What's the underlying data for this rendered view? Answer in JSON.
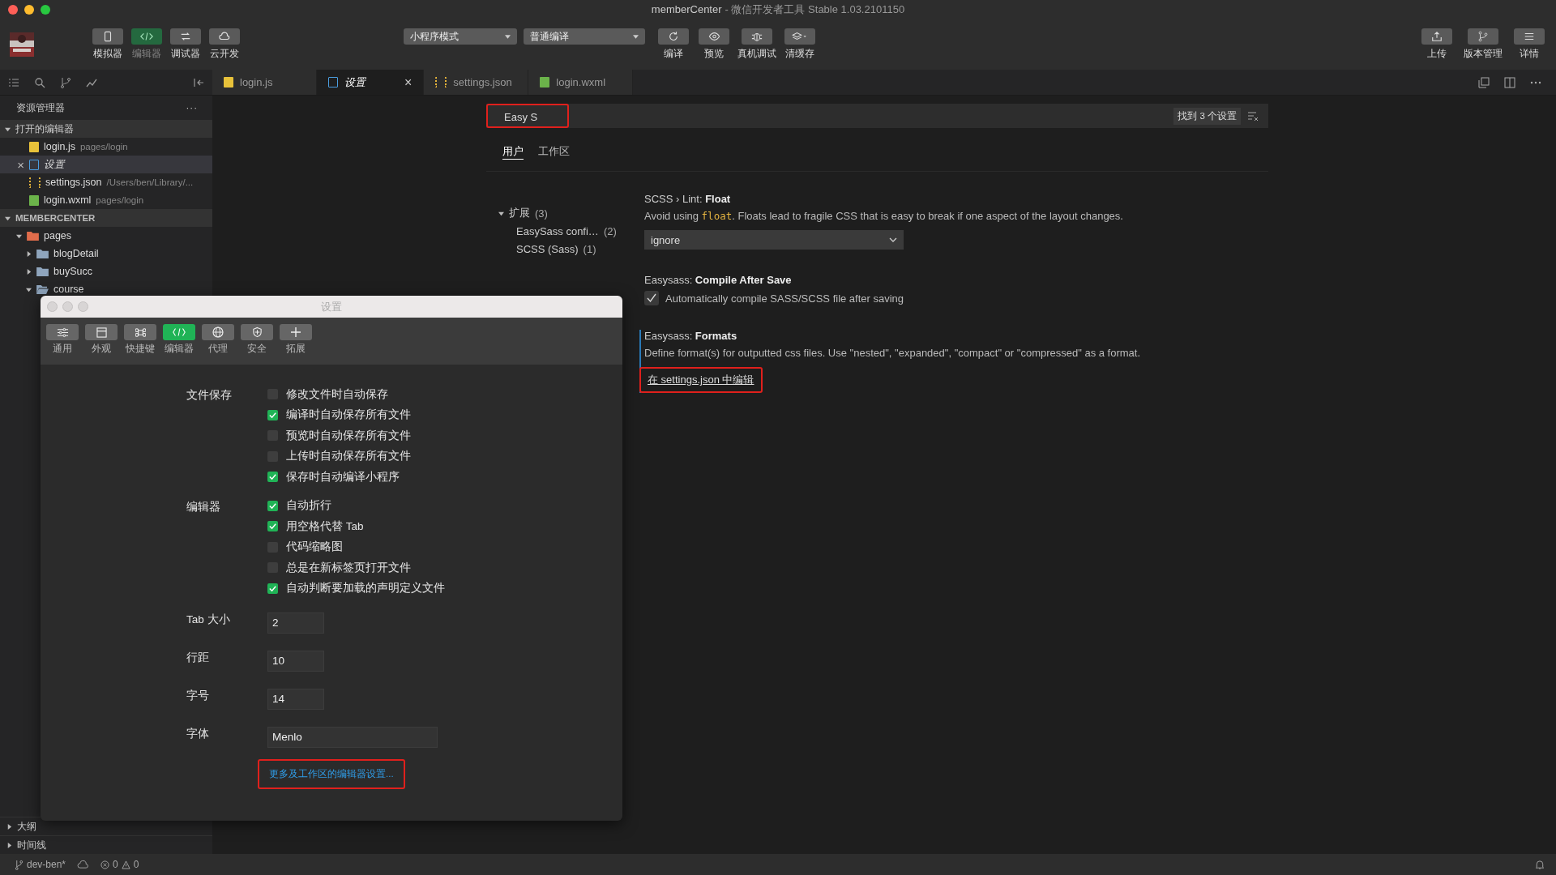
{
  "window": {
    "title": "memberCenter",
    "subtitle": "- 微信开发者工具 Stable 1.03.2101150"
  },
  "toolbar": {
    "left": [
      {
        "label": "模拟器",
        "kind": "phone",
        "selected": false
      },
      {
        "label": "编辑器",
        "kind": "code",
        "selected": true
      },
      {
        "label": "调试器",
        "kind": "debug",
        "selected": false
      },
      {
        "label": "云开发",
        "kind": "cloud",
        "selected": false
      }
    ],
    "mode": "小程序模式",
    "compile": "普通编译",
    "actions": [
      {
        "label": "编译",
        "kind": "refresh"
      },
      {
        "label": "预览",
        "kind": "eye"
      },
      {
        "label": "真机调试",
        "kind": "bug"
      },
      {
        "label": "清缓存",
        "kind": "layers"
      }
    ],
    "right": [
      {
        "label": "上传",
        "kind": "upload"
      },
      {
        "label": "版本管理",
        "kind": "branch"
      },
      {
        "label": "详情",
        "kind": "menu"
      }
    ]
  },
  "tabs": [
    {
      "label": "login.js",
      "kind": "js",
      "selected": false
    },
    {
      "label": "设置",
      "kind": "file",
      "selected": true,
      "close": "×"
    },
    {
      "label": "settings.json",
      "kind": "json",
      "selected": false
    },
    {
      "label": "login.wxml",
      "kind": "wxml",
      "selected": false
    }
  ],
  "sidebar": {
    "title": "资源管理器",
    "more": "···",
    "open_editors": {
      "label": "打开的编辑器",
      "items": [
        {
          "name": "login.js",
          "path": "pages/login",
          "kind": "js",
          "selected": false
        },
        {
          "name": "设置",
          "kind": "file",
          "selected": true,
          "close": "×"
        },
        {
          "name": "settings.json",
          "path": "/Users/ben/Library/...",
          "kind": "json",
          "selected": false
        },
        {
          "name": "login.wxml",
          "path": "pages/login",
          "kind": "wxml",
          "selected": false
        }
      ]
    },
    "project": {
      "label": "MEMBERCENTER",
      "tree": [
        {
          "name": "pages",
          "kind": "root",
          "expanded": true,
          "children": [
            {
              "name": "blogDetail",
              "expanded": false
            },
            {
              "name": "buySucc",
              "expanded": false
            },
            {
              "name": "course",
              "expanded": true
            }
          ]
        }
      ]
    },
    "bottom": [
      {
        "label": "大纲"
      },
      {
        "label": "时间线"
      }
    ]
  },
  "settings": {
    "search": {
      "value": "Easy S",
      "highlighted": true
    },
    "result_count": "找到 3 个设置",
    "scopes": [
      {
        "label": "用户",
        "selected": true
      },
      {
        "label": "工作区",
        "selected": false
      }
    ],
    "toc": [
      {
        "label": "扩展",
        "count": "(3)",
        "expanded": true,
        "children": [
          {
            "label": "EasySass confi…",
            "count": "(2)"
          },
          {
            "label": "SCSS (Sass)",
            "count": "(1)"
          }
        ]
      }
    ],
    "items": [
      {
        "kind": "select",
        "category": "SCSS › Lint: ",
        "name": "Float",
        "description_before": "Avoid using ",
        "code": "float",
        "description_after": ". Floats lead to fragile CSS that is easy to break if one aspect of the layout changes.",
        "value": "ignore"
      },
      {
        "kind": "checkbox",
        "category": "Easysass: ",
        "name": "Compile After Save",
        "label": "Automatically compile SASS/SCSS file after saving",
        "checked": true
      },
      {
        "kind": "link",
        "category": "Easysass: ",
        "name": "Formats",
        "description": "Define format(s) for outputted css files. Use \"nested\", \"expanded\", \"compact\" or \"compressed\" as a format.",
        "link": "在 settings.json 中编辑",
        "focused": true,
        "highlighted": true
      }
    ]
  },
  "dialog": {
    "title": "设置",
    "tabs": [
      {
        "label": "通用",
        "kind": "list",
        "selected": false
      },
      {
        "label": "外观",
        "kind": "window",
        "selected": false
      },
      {
        "label": "快捷键",
        "kind": "command",
        "selected": false
      },
      {
        "label": "编辑器",
        "kind": "code",
        "selected": true
      },
      {
        "label": "代理",
        "kind": "globe",
        "selected": false
      },
      {
        "label": "安全",
        "kind": "shield",
        "selected": false
      },
      {
        "label": "拓展",
        "kind": "plus",
        "selected": false
      }
    ],
    "groups": [
      {
        "label": "文件保存",
        "options": [
          {
            "label": "修改文件时自动保存",
            "checked": false
          },
          {
            "label": "编译时自动保存所有文件",
            "checked": true
          },
          {
            "label": "预览时自动保存所有文件",
            "checked": false
          },
          {
            "label": "上传时自动保存所有文件",
            "checked": false
          },
          {
            "label": "保存时自动编译小程序",
            "checked": true
          }
        ]
      },
      {
        "label": "编辑器",
        "options": [
          {
            "label": "自动折行",
            "checked": true
          },
          {
            "label": "用空格代替 Tab",
            "checked": true
          },
          {
            "label": "代码缩略图",
            "checked": false
          },
          {
            "label": "总是在新标签页打开文件",
            "checked": false
          },
          {
            "label": "自动判断要加载的声明定义文件",
            "checked": true
          }
        ]
      }
    ],
    "fields": [
      {
        "label": "Tab 大小",
        "value": "2",
        "kind": "short"
      },
      {
        "label": "行距",
        "value": "10",
        "kind": "short"
      },
      {
        "label": "字号",
        "value": "14",
        "kind": "short"
      },
      {
        "label": "字体",
        "value": "Menlo",
        "kind": "long"
      }
    ],
    "link": {
      "text": "更多及工作区的编辑器设置...",
      "highlighted": true
    }
  },
  "status_bar": {
    "branch": "dev-ben*",
    "errors": "0",
    "warnings": "0"
  }
}
